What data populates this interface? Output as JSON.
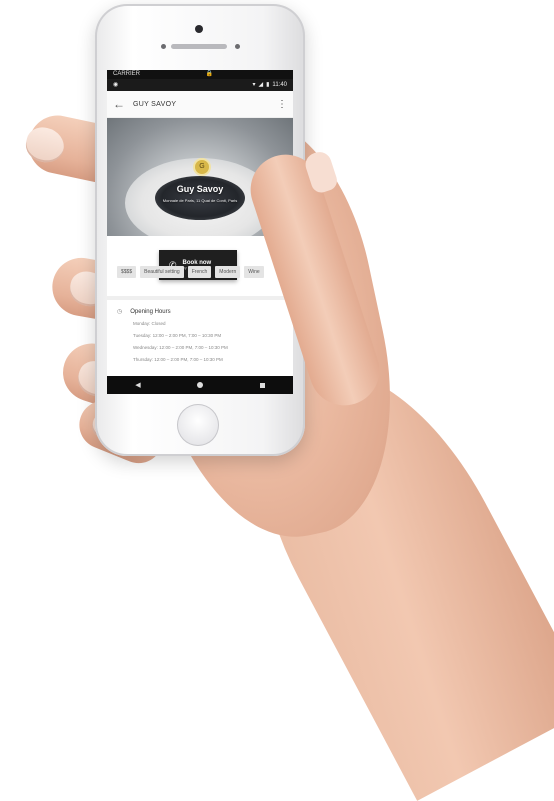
{
  "status": {
    "carrier": "CARRIER",
    "time": "11:40"
  },
  "app_bar": {
    "title": "GUY SAVOY"
  },
  "hero": {
    "restaurant_name": "Guy Savoy",
    "address": "Monnaie de Paris, 11 Quai de Conti, Paris"
  },
  "book": {
    "label": "Book now",
    "sub_label": "by phone"
  },
  "tags": [
    "$$$$",
    "Beautiful setting",
    "French",
    "Modern",
    "Wine"
  ],
  "hours": {
    "title": "Opening Hours",
    "lines": [
      "Monday: Closed",
      "Tuesday: 12:00 – 2:00 PM, 7:00 – 10:30 PM",
      "Wednesday: 12:00 – 2:00 PM, 7:00 – 10:30 PM",
      "Thursday: 12:00 – 2:00 PM, 7:00 – 10:30 PM"
    ]
  },
  "colors": {
    "book_button": "#1f1f1f",
    "tag_bg": "#e4e4e4",
    "nav_bar": "#0d0d0d"
  },
  "icons": {
    "back": "arrow-left-icon",
    "more": "more-vertical-icon",
    "phone": "phone-icon",
    "clock": "clock-icon"
  }
}
